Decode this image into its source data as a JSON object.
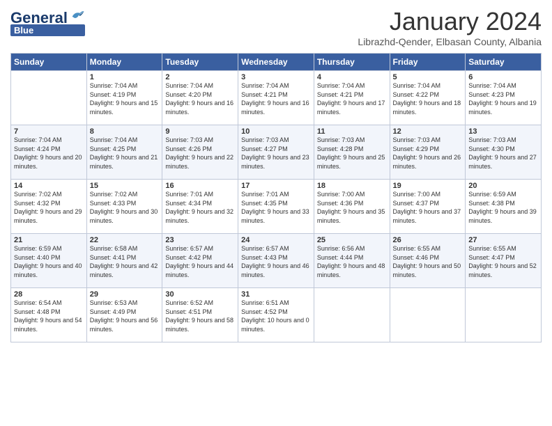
{
  "header": {
    "logo_line1": "General",
    "logo_line2": "Blue",
    "title": "January 2024",
    "subtitle": "Librazhd-Qender, Elbasan County, Albania"
  },
  "columns": [
    "Sunday",
    "Monday",
    "Tuesday",
    "Wednesday",
    "Thursday",
    "Friday",
    "Saturday"
  ],
  "weeks": [
    [
      {
        "day": "",
        "sunrise": "",
        "sunset": "",
        "daylight": ""
      },
      {
        "day": "1",
        "sunrise": "Sunrise: 7:04 AM",
        "sunset": "Sunset: 4:19 PM",
        "daylight": "Daylight: 9 hours and 15 minutes."
      },
      {
        "day": "2",
        "sunrise": "Sunrise: 7:04 AM",
        "sunset": "Sunset: 4:20 PM",
        "daylight": "Daylight: 9 hours and 16 minutes."
      },
      {
        "day": "3",
        "sunrise": "Sunrise: 7:04 AM",
        "sunset": "Sunset: 4:21 PM",
        "daylight": "Daylight: 9 hours and 16 minutes."
      },
      {
        "day": "4",
        "sunrise": "Sunrise: 7:04 AM",
        "sunset": "Sunset: 4:21 PM",
        "daylight": "Daylight: 9 hours and 17 minutes."
      },
      {
        "day": "5",
        "sunrise": "Sunrise: 7:04 AM",
        "sunset": "Sunset: 4:22 PM",
        "daylight": "Daylight: 9 hours and 18 minutes."
      },
      {
        "day": "6",
        "sunrise": "Sunrise: 7:04 AM",
        "sunset": "Sunset: 4:23 PM",
        "daylight": "Daylight: 9 hours and 19 minutes."
      }
    ],
    [
      {
        "day": "7",
        "sunrise": "Sunrise: 7:04 AM",
        "sunset": "Sunset: 4:24 PM",
        "daylight": "Daylight: 9 hours and 20 minutes."
      },
      {
        "day": "8",
        "sunrise": "Sunrise: 7:04 AM",
        "sunset": "Sunset: 4:25 PM",
        "daylight": "Daylight: 9 hours and 21 minutes."
      },
      {
        "day": "9",
        "sunrise": "Sunrise: 7:03 AM",
        "sunset": "Sunset: 4:26 PM",
        "daylight": "Daylight: 9 hours and 22 minutes."
      },
      {
        "day": "10",
        "sunrise": "Sunrise: 7:03 AM",
        "sunset": "Sunset: 4:27 PM",
        "daylight": "Daylight: 9 hours and 23 minutes."
      },
      {
        "day": "11",
        "sunrise": "Sunrise: 7:03 AM",
        "sunset": "Sunset: 4:28 PM",
        "daylight": "Daylight: 9 hours and 25 minutes."
      },
      {
        "day": "12",
        "sunrise": "Sunrise: 7:03 AM",
        "sunset": "Sunset: 4:29 PM",
        "daylight": "Daylight: 9 hours and 26 minutes."
      },
      {
        "day": "13",
        "sunrise": "Sunrise: 7:03 AM",
        "sunset": "Sunset: 4:30 PM",
        "daylight": "Daylight: 9 hours and 27 minutes."
      }
    ],
    [
      {
        "day": "14",
        "sunrise": "Sunrise: 7:02 AM",
        "sunset": "Sunset: 4:32 PM",
        "daylight": "Daylight: 9 hours and 29 minutes."
      },
      {
        "day": "15",
        "sunrise": "Sunrise: 7:02 AM",
        "sunset": "Sunset: 4:33 PM",
        "daylight": "Daylight: 9 hours and 30 minutes."
      },
      {
        "day": "16",
        "sunrise": "Sunrise: 7:01 AM",
        "sunset": "Sunset: 4:34 PM",
        "daylight": "Daylight: 9 hours and 32 minutes."
      },
      {
        "day": "17",
        "sunrise": "Sunrise: 7:01 AM",
        "sunset": "Sunset: 4:35 PM",
        "daylight": "Daylight: 9 hours and 33 minutes."
      },
      {
        "day": "18",
        "sunrise": "Sunrise: 7:00 AM",
        "sunset": "Sunset: 4:36 PM",
        "daylight": "Daylight: 9 hours and 35 minutes."
      },
      {
        "day": "19",
        "sunrise": "Sunrise: 7:00 AM",
        "sunset": "Sunset: 4:37 PM",
        "daylight": "Daylight: 9 hours and 37 minutes."
      },
      {
        "day": "20",
        "sunrise": "Sunrise: 6:59 AM",
        "sunset": "Sunset: 4:38 PM",
        "daylight": "Daylight: 9 hours and 39 minutes."
      }
    ],
    [
      {
        "day": "21",
        "sunrise": "Sunrise: 6:59 AM",
        "sunset": "Sunset: 4:40 PM",
        "daylight": "Daylight: 9 hours and 40 minutes."
      },
      {
        "day": "22",
        "sunrise": "Sunrise: 6:58 AM",
        "sunset": "Sunset: 4:41 PM",
        "daylight": "Daylight: 9 hours and 42 minutes."
      },
      {
        "day": "23",
        "sunrise": "Sunrise: 6:57 AM",
        "sunset": "Sunset: 4:42 PM",
        "daylight": "Daylight: 9 hours and 44 minutes."
      },
      {
        "day": "24",
        "sunrise": "Sunrise: 6:57 AM",
        "sunset": "Sunset: 4:43 PM",
        "daylight": "Daylight: 9 hours and 46 minutes."
      },
      {
        "day": "25",
        "sunrise": "Sunrise: 6:56 AM",
        "sunset": "Sunset: 4:44 PM",
        "daylight": "Daylight: 9 hours and 48 minutes."
      },
      {
        "day": "26",
        "sunrise": "Sunrise: 6:55 AM",
        "sunset": "Sunset: 4:46 PM",
        "daylight": "Daylight: 9 hours and 50 minutes."
      },
      {
        "day": "27",
        "sunrise": "Sunrise: 6:55 AM",
        "sunset": "Sunset: 4:47 PM",
        "daylight": "Daylight: 9 hours and 52 minutes."
      }
    ],
    [
      {
        "day": "28",
        "sunrise": "Sunrise: 6:54 AM",
        "sunset": "Sunset: 4:48 PM",
        "daylight": "Daylight: 9 hours and 54 minutes."
      },
      {
        "day": "29",
        "sunrise": "Sunrise: 6:53 AM",
        "sunset": "Sunset: 4:49 PM",
        "daylight": "Daylight: 9 hours and 56 minutes."
      },
      {
        "day": "30",
        "sunrise": "Sunrise: 6:52 AM",
        "sunset": "Sunset: 4:51 PM",
        "daylight": "Daylight: 9 hours and 58 minutes."
      },
      {
        "day": "31",
        "sunrise": "Sunrise: 6:51 AM",
        "sunset": "Sunset: 4:52 PM",
        "daylight": "Daylight: 10 hours and 0 minutes."
      },
      {
        "day": "",
        "sunrise": "",
        "sunset": "",
        "daylight": ""
      },
      {
        "day": "",
        "sunrise": "",
        "sunset": "",
        "daylight": ""
      },
      {
        "day": "",
        "sunrise": "",
        "sunset": "",
        "daylight": ""
      }
    ]
  ]
}
